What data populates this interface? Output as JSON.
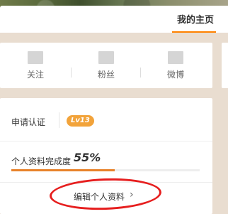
{
  "header": {
    "tab_home": "我的主页"
  },
  "stats": [
    {
      "value": "",
      "label": "关注"
    },
    {
      "value": "",
      "label": "粉丝"
    },
    {
      "value": "",
      "label": "微博"
    }
  ],
  "profile": {
    "verify_label": "申请认证",
    "level_badge": "Lv13",
    "completion_label": "个人资料完成度",
    "completion_value": "55%",
    "completion_fraction": 0.55,
    "edit_link": "编辑个人资料",
    "edit_chevron": "›"
  },
  "colors": {
    "accent": "#ff8200",
    "badge": "#f2a33a",
    "progress": "#e8822a",
    "annotation": "#e61e1e"
  }
}
